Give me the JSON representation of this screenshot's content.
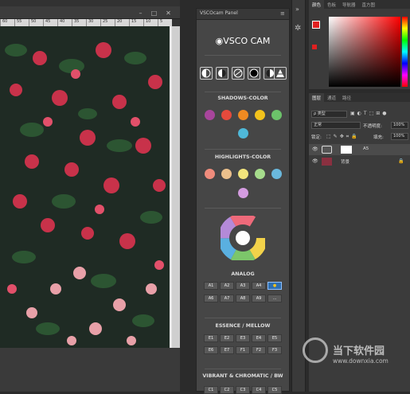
{
  "ruler": {
    "ticks": [
      "60",
      "55",
      "50",
      "45",
      "40",
      "35",
      "30",
      "25",
      "20",
      "15",
      "10",
      "5"
    ]
  },
  "vsco": {
    "tab_title": "VSCOcam Panel",
    "logo": "◉VSCO CAM",
    "sections": {
      "shadows": "SHADOWS-COLOR",
      "highlights": "HIGHLIGHTS-COLOR",
      "analog": "ANALOG",
      "essence": "ESSENCE / MELLOW",
      "vibrant": "VIBRANT & CHROMATIC / BW"
    },
    "shadow_colors": [
      "#a8459c",
      "#e64a3c",
      "#ee8a22",
      "#f2c21c",
      "#6cc26a",
      "#4fb8d8"
    ],
    "highlight_colors": [
      "#f08c7c",
      "#ecc08c",
      "#f2e47c",
      "#a6dc8c",
      "#6ab8dc",
      "#d49ce0"
    ],
    "analog_buttons": [
      "A1",
      "A2",
      "A3",
      "A4",
      "",
      "A6",
      "A7",
      "A8",
      "A9",
      "..."
    ],
    "essence_buttons": [
      "E1",
      "E2",
      "E3",
      "E4",
      "E5",
      "E6",
      "E7",
      "F1",
      "F2",
      "F3"
    ],
    "vibrant_buttons": [
      "C1",
      "C2",
      "C3",
      "C4",
      "C5"
    ]
  },
  "color_panel": {
    "tabs": [
      "颜色",
      "色板",
      "导航器",
      "直方图"
    ]
  },
  "layers_panel": {
    "tabs": [
      "图层",
      "通道",
      "路径"
    ],
    "filter": "ρ 类型",
    "blend": "正常",
    "opacity_label": "不透明度:",
    "opacity": "100%",
    "lock_label": "锁定:",
    "fill_label": "填充:",
    "fill": "100%",
    "layers": [
      {
        "name": "A5"
      },
      {
        "name": "背景"
      }
    ]
  },
  "watermark": {
    "name": "当下软件园",
    "url": "www.downxia.com"
  }
}
